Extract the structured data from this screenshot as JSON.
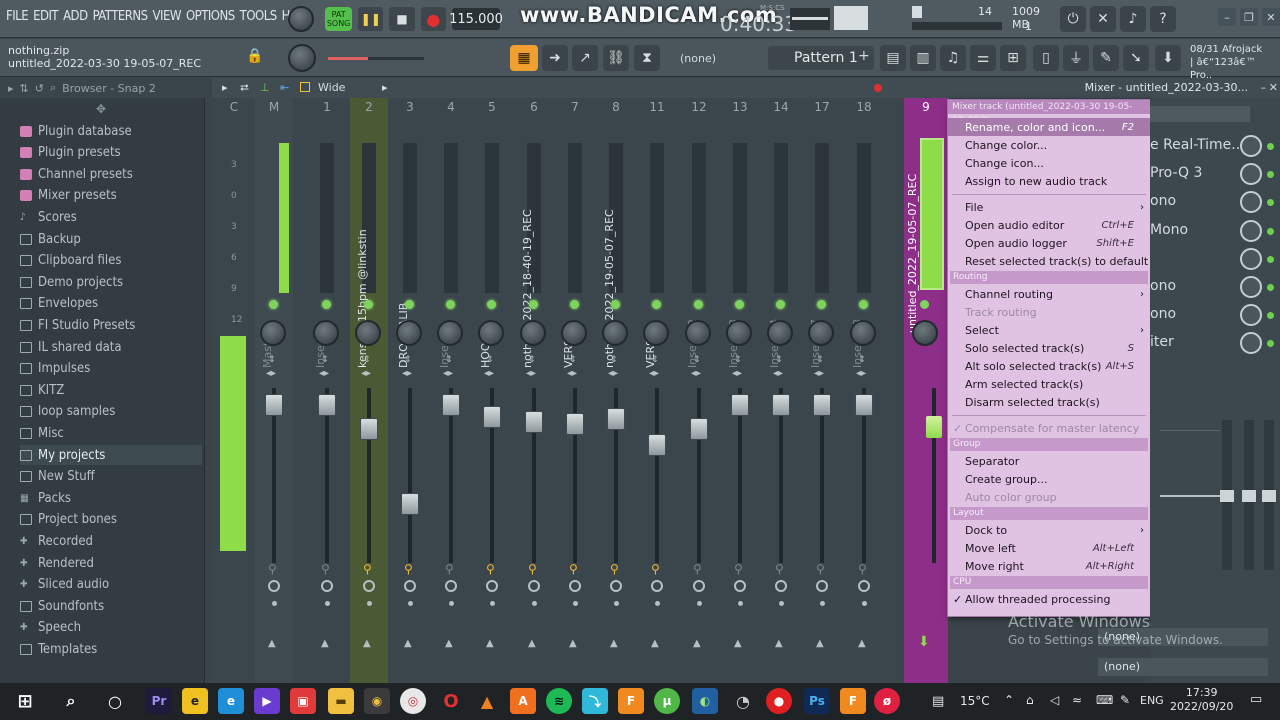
{
  "menu": [
    "FILE",
    "EDIT",
    "ADD",
    "PATTERNS",
    "VIEW",
    "OPTIONS",
    "TOOLS",
    "HELP"
  ],
  "transport": {
    "pat_label": "PAT",
    "song_label": "SONG",
    "bpm": "115.000"
  },
  "overlay": {
    "watermark": "www.BANDICAM.com",
    "time": "0:40:33",
    "time_unit": "M:S:CS"
  },
  "cpu": {
    "value": "14",
    "memory": "1009 MB",
    "count": "1"
  },
  "project": {
    "zip": "nothing.zip",
    "name": "untitled_2022-03-30 19-05-07_REC"
  },
  "toolbar2": {
    "none_label": "(none)",
    "pattern": "Pattern 1",
    "plus": "+"
  },
  "hint": {
    "line1": "08/31  Afrojack",
    "line2": "| â€“123â€™ Pro.."
  },
  "browser": {
    "header": "Browser - Snap 2",
    "items": [
      {
        "label": "Plugin database",
        "icon": "pink"
      },
      {
        "label": "Plugin presets",
        "icon": "pink"
      },
      {
        "label": "Channel presets",
        "icon": "pink"
      },
      {
        "label": "Mixer presets",
        "icon": "pink"
      },
      {
        "label": "Scores",
        "icon": "note"
      },
      {
        "label": "Backup",
        "icon": "folder"
      },
      {
        "label": "Clipboard files",
        "icon": "folder"
      },
      {
        "label": "Demo projects",
        "icon": "folder"
      },
      {
        "label": "Envelopes",
        "icon": "folder"
      },
      {
        "label": "FI Studio Presets",
        "icon": "folder"
      },
      {
        "label": "IL shared data",
        "icon": "folder"
      },
      {
        "label": "Impulses",
        "icon": "folder"
      },
      {
        "label": "KITZ",
        "icon": "folder"
      },
      {
        "label": "loop samples",
        "icon": "folder"
      },
      {
        "label": "Misc",
        "icon": "folder"
      },
      {
        "label": "My projects",
        "icon": "folder"
      },
      {
        "label": "New Stuff",
        "icon": "folder"
      },
      {
        "label": "Packs",
        "icon": "pack"
      },
      {
        "label": "Project bones",
        "icon": "folder"
      },
      {
        "label": "Recorded",
        "icon": "plus"
      },
      {
        "label": "Rendered",
        "icon": "plus"
      },
      {
        "label": "Sliced audio",
        "icon": "plus"
      },
      {
        "label": "Soundfonts",
        "icon": "folder"
      },
      {
        "label": "Speech",
        "icon": "plus"
      },
      {
        "label": "Templates",
        "icon": "folder"
      }
    ],
    "selected": "My projects"
  },
  "mixer": {
    "view": "Wide",
    "title": "Mixer - untitled_2022-03-30...",
    "strips": [
      {
        "num": "C",
        "name": "",
        "dim": true
      },
      {
        "num": "M",
        "name": "Master",
        "dim": true
      },
      {
        "num": "1",
        "name": "Insert 1",
        "dim": true
      },
      {
        "num": "2",
        "name": "kensui 115bpm @linkstin",
        "dim": false
      },
      {
        "num": "3",
        "name": "DROGBALIB",
        "dim": false
      },
      {
        "num": "4",
        "name": "Insert 4",
        "dim": true
      },
      {
        "num": "5",
        "name": "HOOK",
        "dim": false
      },
      {
        "num": "6",
        "name": "nothing_2022_18-40-19_REC",
        "dim": false
      },
      {
        "num": "7",
        "name": "VERSE1",
        "dim": false
      },
      {
        "num": "8",
        "name": "nothing_2022_19-05-07_REC",
        "dim": false
      },
      {
        "num": "11",
        "name": "VERSE2",
        "dim": false
      },
      {
        "num": "12",
        "name": "Insert 12",
        "dim": true
      },
      {
        "num": "13",
        "name": "Insert 13",
        "dim": true
      },
      {
        "num": "14",
        "name": "Insert 14",
        "dim": true
      },
      {
        "num": "17",
        "name": "Insert 17",
        "dim": true
      },
      {
        "num": "18",
        "name": "Insert 18",
        "dim": true
      }
    ],
    "strip9": {
      "num": "9",
      "name": "untitled_2022_19-05-07_REC"
    },
    "db_ticks": [
      "3",
      "0",
      "3",
      "6",
      "9",
      "12"
    ]
  },
  "context_menu": {
    "header": "Mixer track (untitled_2022-03-30 19-05-07_REC)",
    "items": [
      {
        "label": "Rename, color and icon...",
        "shortcut": "F2",
        "highlight": true
      },
      {
        "label": "Change color..."
      },
      {
        "label": "Change icon..."
      },
      {
        "label": "Assign to new audio track"
      },
      {
        "label": "File",
        "submenu": true
      },
      {
        "label": "Open audio editor",
        "shortcut": "Ctrl+E"
      },
      {
        "label": "Open audio logger",
        "shortcut": "Shift+E"
      },
      {
        "label": "Reset selected track(s) to default"
      },
      {
        "section": "Routing"
      },
      {
        "label": "Channel routing",
        "submenu": true
      },
      {
        "label": "Track routing",
        "disabled": true
      },
      {
        "label": "Select",
        "submenu": true
      },
      {
        "label": "Solo selected track(s)",
        "shortcut": "S"
      },
      {
        "label": "Alt solo selected track(s)",
        "shortcut": "Alt+S"
      },
      {
        "label": "Arm selected track(s)"
      },
      {
        "label": "Disarm selected track(s)"
      },
      {
        "label": "Compensate for master latency",
        "disabled": true,
        "check": true
      },
      {
        "section": "Group"
      },
      {
        "label": "Separator"
      },
      {
        "label": "Create group..."
      },
      {
        "label": "Auto color group",
        "disabled": true
      },
      {
        "section": "Layout"
      },
      {
        "label": "Dock to",
        "submenu": true
      },
      {
        "label": "Move left",
        "shortcut": "Alt+Left"
      },
      {
        "label": "Move right",
        "shortcut": "Alt+Right"
      },
      {
        "section": "CPU"
      },
      {
        "label": "Allow threaded processing",
        "check": true
      }
    ]
  },
  "right_panel": {
    "slots": [
      "e Real-Time..",
      "Pro-Q 3",
      "ono",
      "Mono",
      "",
      "ono",
      "ono",
      "iter"
    ],
    "none1": "(none)",
    "none2": "(none)"
  },
  "windows_notice": {
    "title": "Activate Windows",
    "subtitle": "Go to Settings to activate Windows."
  },
  "taskbar": {
    "temp": "15°C",
    "lang": "ENG",
    "time": "17:39",
    "date": "2022/09/20"
  }
}
